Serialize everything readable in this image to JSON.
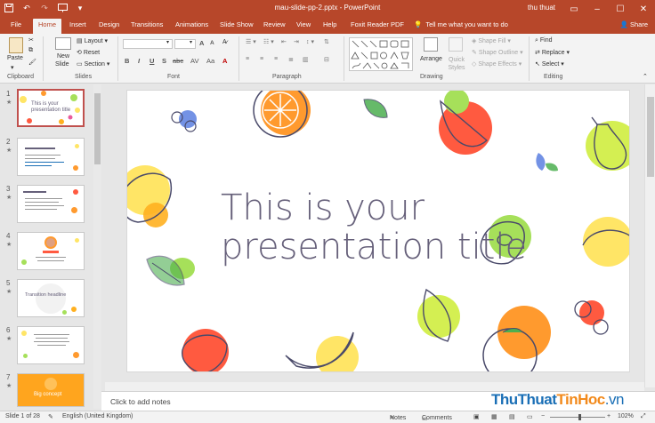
{
  "app": {
    "title": "mau-slide-pp-2.pptx  -  PowerPoint",
    "user": "thu thuat",
    "colors": {
      "brand": "#b7472a",
      "title_text": "#66607a",
      "watermark_blue": "#1a6fb6",
      "watermark_orange": "#f28a1c"
    }
  },
  "tabs": [
    "File",
    "Home",
    "Insert",
    "Design",
    "Transitions",
    "Animations",
    "Slide Show",
    "Review",
    "View",
    "Help",
    "Foxit Reader PDF"
  ],
  "tellme": "Tell me what you want to do",
  "share": "Share",
  "ribbon": {
    "clipboard": {
      "paste": "Paste",
      "label": "Clipboard"
    },
    "slides": {
      "new_slide_line1": "New",
      "new_slide_line2": "Slide",
      "layout": "Layout",
      "reset": "Reset",
      "section": "Section",
      "label": "Slides"
    },
    "font": {
      "label": "Font",
      "bold": "B",
      "italic": "I",
      "underline": "U",
      "strike": "S",
      "shadow": "abc",
      "spacing": "AV",
      "case": "Aa",
      "grow": "A",
      "shrink": "A"
    },
    "paragraph": {
      "label": "Paragraph"
    },
    "drawing": {
      "arrange": "Arrange",
      "quick_styles": "Quick Styles",
      "shape_fill": "Shape Fill",
      "shape_outline": "Shape Outline",
      "shape_effects": "Shape Effects",
      "label": "Drawing"
    },
    "editing": {
      "find": "Find",
      "replace": "Replace",
      "select": "Select",
      "label": "Editing"
    }
  },
  "thumbnails": [
    {
      "num": "1",
      "active": true
    },
    {
      "num": "2",
      "active": false
    },
    {
      "num": "3",
      "active": false
    },
    {
      "num": "4",
      "active": false
    },
    {
      "num": "5",
      "active": false
    },
    {
      "num": "6",
      "active": false
    },
    {
      "num": "7",
      "active": false
    }
  ],
  "thumb_texts": {
    "t1": "This is your presentation title",
    "t5": "Transition headline",
    "t7": "Big concept"
  },
  "slide": {
    "title_line1": "This is your",
    "title_line2": "presentation title"
  },
  "notes": "Click to add notes",
  "status": {
    "slide": "Slide 1 of 28",
    "language": "English (United Kingdom)",
    "notes": "Notes",
    "comments": "Comments",
    "zoom": "102%"
  },
  "watermark": {
    "part1": "ThuThuat",
    "part2": "TinHoc",
    "part3": ".vn"
  }
}
